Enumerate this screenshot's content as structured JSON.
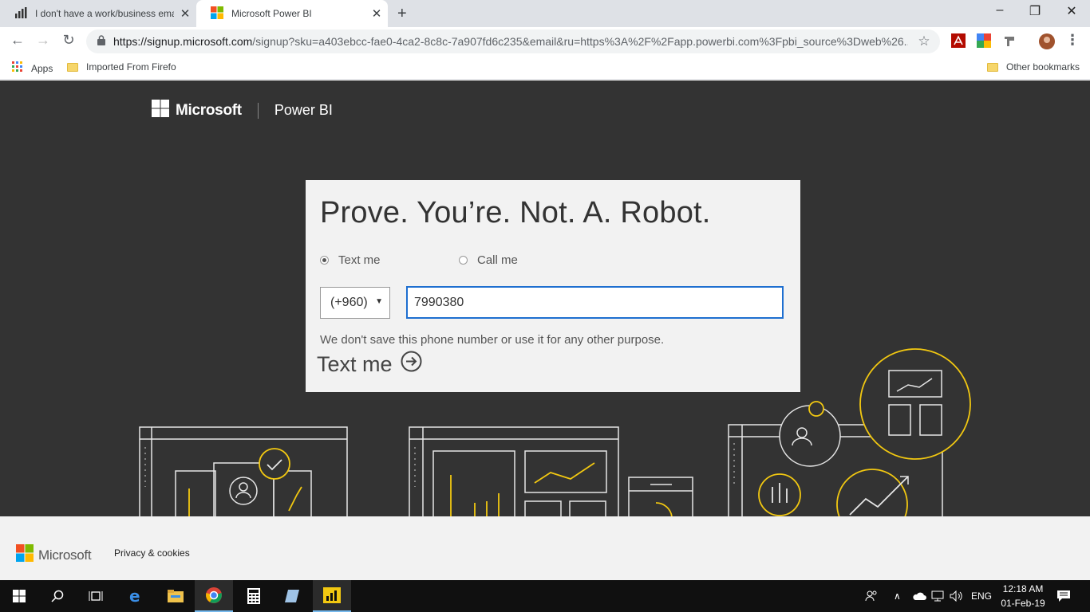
{
  "browser": {
    "tabs": [
      {
        "title": "I don't have a work/business ema",
        "icon": "bar-chart-icon"
      },
      {
        "title": "Microsoft Power BI",
        "icon": "microsoft-logo-icon"
      }
    ],
    "url_host": "https://signup.microsoft.com",
    "url_rest": "/signup?sku=a403ebcc-fae0-4ca2-8c8c-7a907fd6c235&email&ru=https%3A%2F%2Fapp.powerbi.com%3Fpbi_source%3Dweb%26...",
    "bookmarks": {
      "apps": "Apps",
      "imported": "Imported From Firefo",
      "other": "Other bookmarks"
    }
  },
  "header": {
    "brand": "Microsoft",
    "product": "Power BI"
  },
  "form": {
    "title": "Prove. You’re. Not. A. Robot.",
    "option_text": "Text me",
    "option_call": "Call me",
    "country_code": "(+960)",
    "phone_value": "7990380",
    "note": "We don't save this phone number or use it for any other purpose.",
    "submit_label": "Text me"
  },
  "footer": {
    "brand": "Microsoft",
    "privacy": "Privacy & cookies"
  },
  "taskbar": {
    "lang": "ENG",
    "time": "12:18 AM",
    "date": "01-Feb-19"
  },
  "colors": {
    "page_bg": "#333333",
    "accent_yellow": "#f2c811",
    "link_blue": "#1e6fd0"
  }
}
